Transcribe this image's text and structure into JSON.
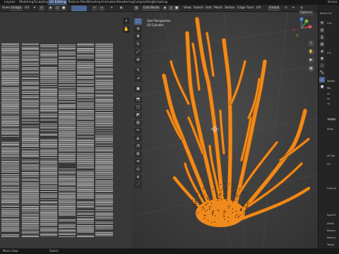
{
  "topbar": {
    "workspaces": [
      "Layout",
      "Modeling",
      "Sculpting",
      "UV Editing",
      "Texture Paint",
      "Shading",
      "Animation",
      "Rendering",
      "Compositing",
      "Scripting"
    ],
    "active_workspace": "UV Editing",
    "scene_label": "Scene"
  },
  "uv_header": {
    "select_label": "Select",
    "image_label": "Image",
    "uv_label": "UV"
  },
  "viewport_header": {
    "mode": "Edit Mode",
    "view": "View",
    "select": "Select",
    "add": "Add",
    "mesh": "Mesh",
    "vertex": "Vertex",
    "edge": "Edge",
    "face": "Face",
    "uv": "UV",
    "orientation": "Global",
    "options": "Options"
  },
  "viewport_info": {
    "line1": "User Perspective",
    "line2": "(0) Cylinder"
  },
  "props": {
    "header": "Scene Co",
    "rows": [
      "Cyli",
      "Cyl",
      "Vertex",
      "Ma",
      "co",
      "co",
      "co",
      "Shap",
      "Assign",
      "UV Ma",
      "UV",
      "Color A",
      "Face M",
      "Attrib",
      "Norma",
      "Norma",
      "Textur"
    ]
  },
  "status": {
    "left": "Move View",
    "right": "Select"
  },
  "colors": {
    "accent": "#4a6694",
    "mesh_orange": "#f08a1c",
    "viewport_bg": "#3a3a3a"
  }
}
